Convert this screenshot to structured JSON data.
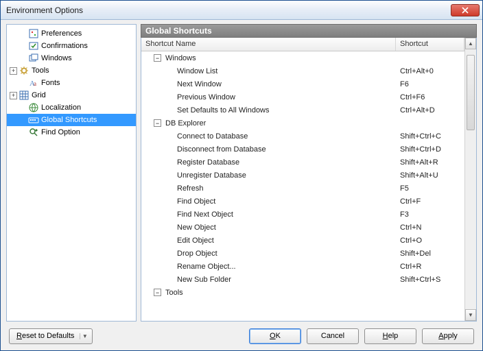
{
  "window": {
    "title": "Environment Options"
  },
  "tree": {
    "items": [
      {
        "label": "Preferences",
        "icon": "pref",
        "expand": null,
        "indent": 1
      },
      {
        "label": "Confirmations",
        "icon": "confirm",
        "expand": null,
        "indent": 1
      },
      {
        "label": "Windows",
        "icon": "windows",
        "expand": null,
        "indent": 1
      },
      {
        "label": "Tools",
        "icon": "tools",
        "expand": "+",
        "indent": 0
      },
      {
        "label": "Fonts",
        "icon": "fonts",
        "expand": null,
        "indent": 1
      },
      {
        "label": "Grid",
        "icon": "grid",
        "expand": "+",
        "indent": 0
      },
      {
        "label": "Localization",
        "icon": "local",
        "expand": null,
        "indent": 1
      },
      {
        "label": "Global Shortcuts",
        "icon": "shortcuts",
        "expand": null,
        "indent": 1,
        "selected": true
      },
      {
        "label": "Find Option",
        "icon": "find",
        "expand": null,
        "indent": 1
      }
    ]
  },
  "section": {
    "title": "Global Shortcuts"
  },
  "grid": {
    "headers": {
      "name": "Shortcut Name",
      "shortcut": "Shortcut"
    },
    "rows": [
      {
        "type": "group",
        "label": "Windows"
      },
      {
        "type": "item",
        "label": "Window List",
        "shortcut": "Ctrl+Alt+0"
      },
      {
        "type": "item",
        "label": "Next Window",
        "shortcut": "F6"
      },
      {
        "type": "item",
        "label": "Previous Window",
        "shortcut": "Ctrl+F6"
      },
      {
        "type": "item",
        "label": "Set Defaults to All Windows",
        "shortcut": "Ctrl+Alt+D"
      },
      {
        "type": "group",
        "label": "DB Explorer"
      },
      {
        "type": "item",
        "label": "Connect to Database",
        "shortcut": "Shift+Ctrl+C"
      },
      {
        "type": "item",
        "label": "Disconnect from Database",
        "shortcut": "Shift+Ctrl+D"
      },
      {
        "type": "item",
        "label": "Register Database",
        "shortcut": "Shift+Alt+R"
      },
      {
        "type": "item",
        "label": "Unregister Database",
        "shortcut": "Shift+Alt+U"
      },
      {
        "type": "item",
        "label": "Refresh",
        "shortcut": "F5"
      },
      {
        "type": "item",
        "label": "Find Object",
        "shortcut": "Ctrl+F"
      },
      {
        "type": "item",
        "label": "Find Next Object",
        "shortcut": "F3"
      },
      {
        "type": "item",
        "label": "New Object",
        "shortcut": "Ctrl+N"
      },
      {
        "type": "item",
        "label": "Edit Object",
        "shortcut": "Ctrl+O"
      },
      {
        "type": "item",
        "label": "Drop Object",
        "shortcut": "Shift+Del"
      },
      {
        "type": "item",
        "label": "Rename Object...",
        "shortcut": "Ctrl+R"
      },
      {
        "type": "item",
        "label": "New Sub Folder",
        "shortcut": "Shift+Ctrl+S"
      },
      {
        "type": "group",
        "label": "Tools"
      }
    ]
  },
  "buttons": {
    "reset": "Reset to Defaults",
    "ok": "OK",
    "cancel": "Cancel",
    "help": "Help",
    "apply": "Apply"
  }
}
